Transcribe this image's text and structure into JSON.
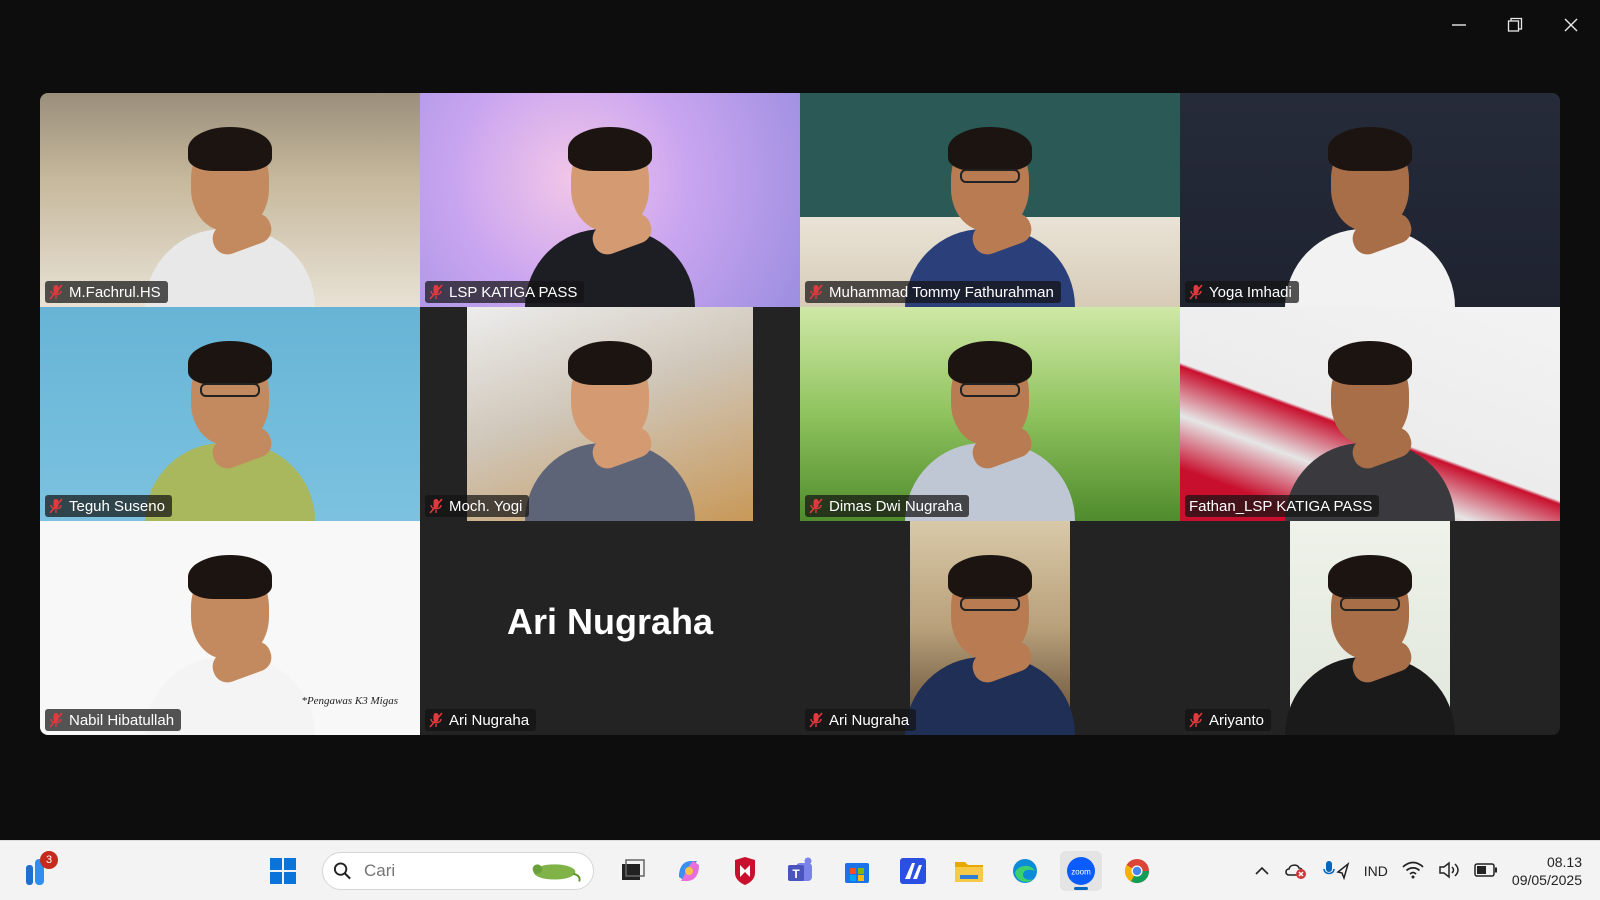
{
  "window": {
    "controls": [
      "minimize",
      "restore",
      "close"
    ]
  },
  "participants": [
    {
      "name": "M.Fachrul.HS",
      "bg": "room1",
      "video": "full"
    },
    {
      "name": "LSP KATIGA PASS",
      "bg": "purple",
      "video": "full"
    },
    {
      "name": "Muhammad Tommy Fathurahman",
      "bg": "class",
      "video": "full"
    },
    {
      "name": "Yoga Imhadi",
      "bg": "navy",
      "video": "full"
    },
    {
      "name": "Teguh Suseno",
      "bg": "blue",
      "video": "full"
    },
    {
      "name": "Moch. Yogi",
      "bg": "office",
      "video": "mid"
    },
    {
      "name": "Dimas Dwi Nugraha",
      "bg": "grass",
      "video": "full"
    },
    {
      "name": "Fathan_LSP KATIGA PASS",
      "bg": "flag",
      "video": "full",
      "active": true
    },
    {
      "name": "Nabil Hibatullah",
      "bg": "white",
      "video": "full",
      "caption": "*Pengawas K3 Migas"
    },
    {
      "name": "Ari Nugraha",
      "bg": "none",
      "video": "off",
      "display_name": "Ari Nugraha"
    },
    {
      "name": "Ari Nugraha",
      "bg": "hotel",
      "video": "narrow"
    },
    {
      "name": "Ariyanto",
      "bg": "pale",
      "video": "narrow"
    }
  ],
  "taskbar": {
    "notification_count": "3",
    "search_placeholder": "Cari",
    "apps": [
      "start",
      "task-view",
      "copilot",
      "mcafee",
      "teams",
      "store",
      "app-a",
      "file-explorer",
      "edge",
      "zoom",
      "chrome"
    ],
    "active_app": "zoom",
    "language": "IND",
    "time": "08.13",
    "date": "09/05/2025"
  },
  "colors": {
    "active_speaker": "#23d160",
    "muted": "#e0393e",
    "taskbar": "#f3f3f3"
  }
}
